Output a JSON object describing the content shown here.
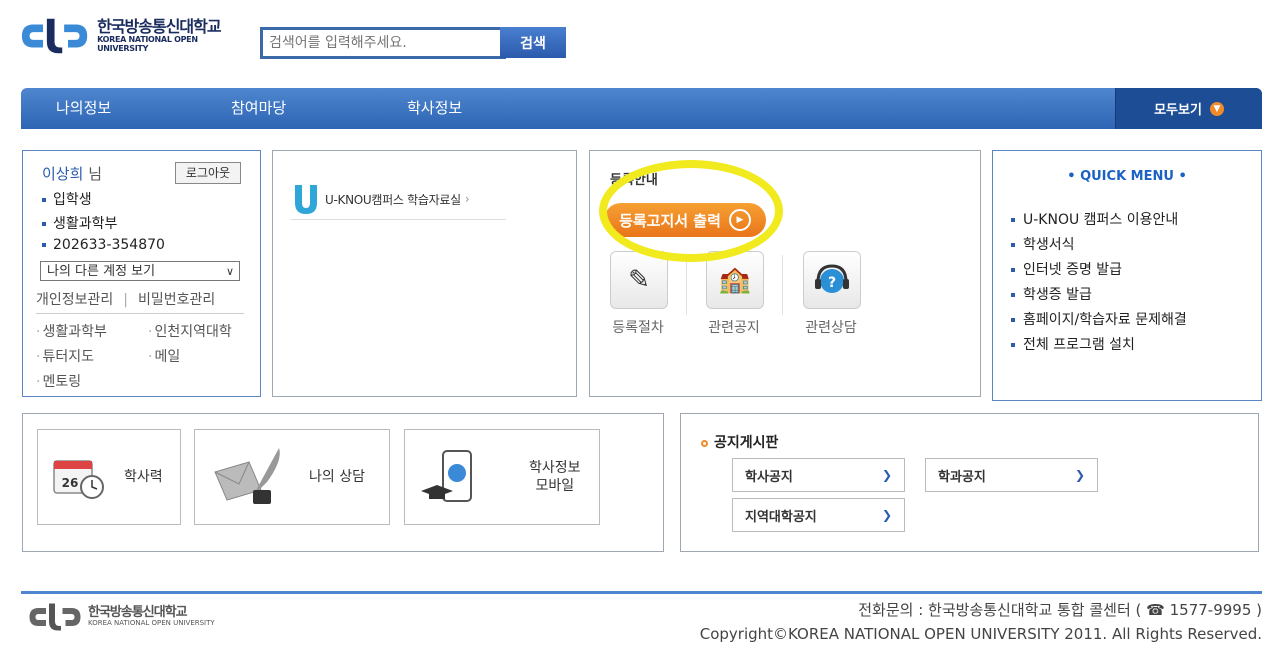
{
  "header": {
    "logo_kr": "한국방송통신대학교",
    "logo_en": "KOREA NATIONAL OPEN UNIVERSITY",
    "search_placeholder": "검색어를 입력해주세요.",
    "search_button": "검색"
  },
  "nav": {
    "items": [
      "나의정보",
      "참여마당",
      "학사정보"
    ],
    "view_all": "모두보기"
  },
  "user": {
    "name": "이상희",
    "suffix": "님",
    "logout": "로그아웃",
    "status": "입학생",
    "department": "생활과학부",
    "student_id": "202633-354870",
    "account_select": "나의 다른 계정 보기",
    "privacy_link": "개인정보관리",
    "password_link": "비밀번호관리",
    "links": [
      "생활과학부",
      "인천지역대학",
      "튜터지도",
      "메일",
      "멘토링"
    ]
  },
  "ucampus": {
    "label": "U-KNOU캠퍼스 학습자료실"
  },
  "registration": {
    "title": "등록안내",
    "print_button": "등록고지서 출력",
    "icons": [
      "등록절차",
      "관련공지",
      "관련상담"
    ]
  },
  "quick_menu": {
    "title": "QUICK MENU",
    "items": [
      "U-KNOU 캠퍼스 이용안내",
      "학생서식",
      "인터넷 증명 발급",
      "학생증 발급",
      "홈페이지/학습자료 문제해결",
      "전체 프로그램 설치"
    ]
  },
  "shortcuts": {
    "calendar": "학사력",
    "counsel": "나의 상담",
    "mobile_line1": "학사정보",
    "mobile_line2": "모바일",
    "calendar_day": "26"
  },
  "notice": {
    "title": "공지게시판",
    "buttons": [
      "학사공지",
      "학과공지",
      "지역대학공지"
    ]
  },
  "footer": {
    "logo_kr": "한국방송통신대학교",
    "logo_en": "KOREA NATIONAL OPEN UNIVERSITY",
    "contact": "전화문의 : 한국방송통신대학교 통합 콜센터 ( ☎ 1577-9995 )",
    "copyright": "Copyright©KOREA NATIONAL OPEN UNIVERSITY 2011. All Rights Reserved."
  },
  "colors": {
    "primary": "#2d65b4",
    "accent": "#f08b2a",
    "highlight": "#f1ea1e"
  }
}
